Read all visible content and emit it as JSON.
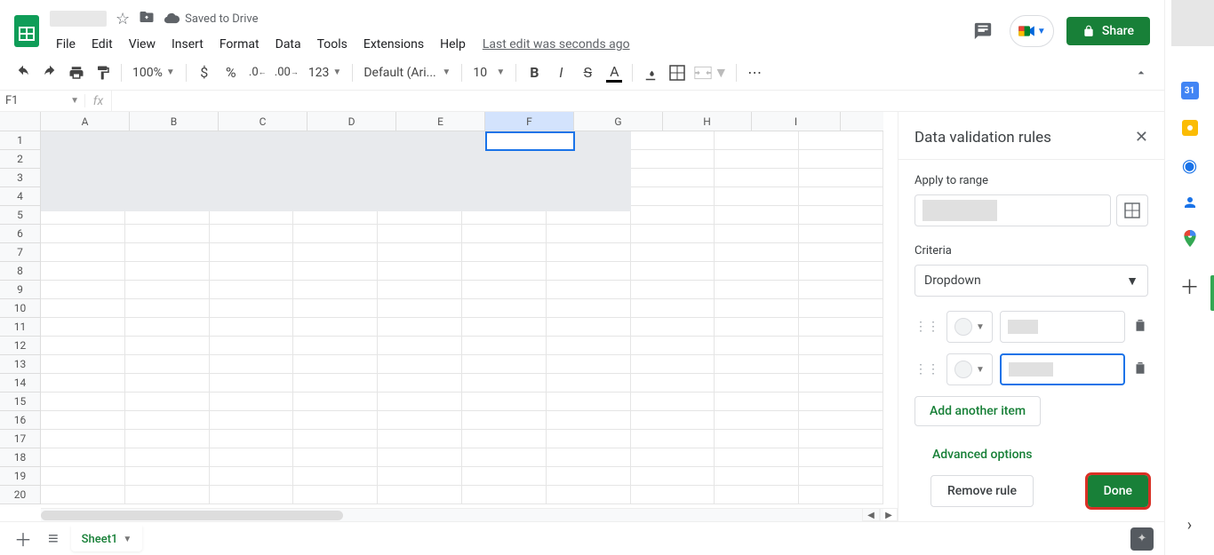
{
  "doc": {
    "saved": "Saved to Drive"
  },
  "menubar": {
    "file": "File",
    "edit": "Edit",
    "view": "View",
    "insert": "Insert",
    "format": "Format",
    "data": "Data",
    "tools": "Tools",
    "extensions": "Extensions",
    "help": "Help",
    "last_edit": "Last edit was seconds ago"
  },
  "header": {
    "share": "Share"
  },
  "toolbar": {
    "zoom": "100%",
    "font": "Default (Ari...",
    "font_size": "10",
    "num_fmt": "123"
  },
  "fx": {
    "name_box": "F1"
  },
  "cols": [
    "A",
    "B",
    "C",
    "D",
    "E",
    "F",
    "G",
    "H",
    "I"
  ],
  "rows": [
    "1",
    "2",
    "3",
    "4",
    "5",
    "6",
    "7",
    "8",
    "9",
    "10",
    "11",
    "12",
    "13",
    "14",
    "15",
    "16",
    "17",
    "18",
    "19",
    "20"
  ],
  "panel": {
    "title": "Data validation rules",
    "apply_label": "Apply to range",
    "criteria_label": "Criteria",
    "criteria_value": "Dropdown",
    "add_item": "Add another item",
    "advanced": "Advanced options",
    "remove": "Remove rule",
    "done": "Done"
  },
  "tabs": {
    "sheet1": "Sheet1"
  },
  "side": {
    "cal": "31"
  }
}
